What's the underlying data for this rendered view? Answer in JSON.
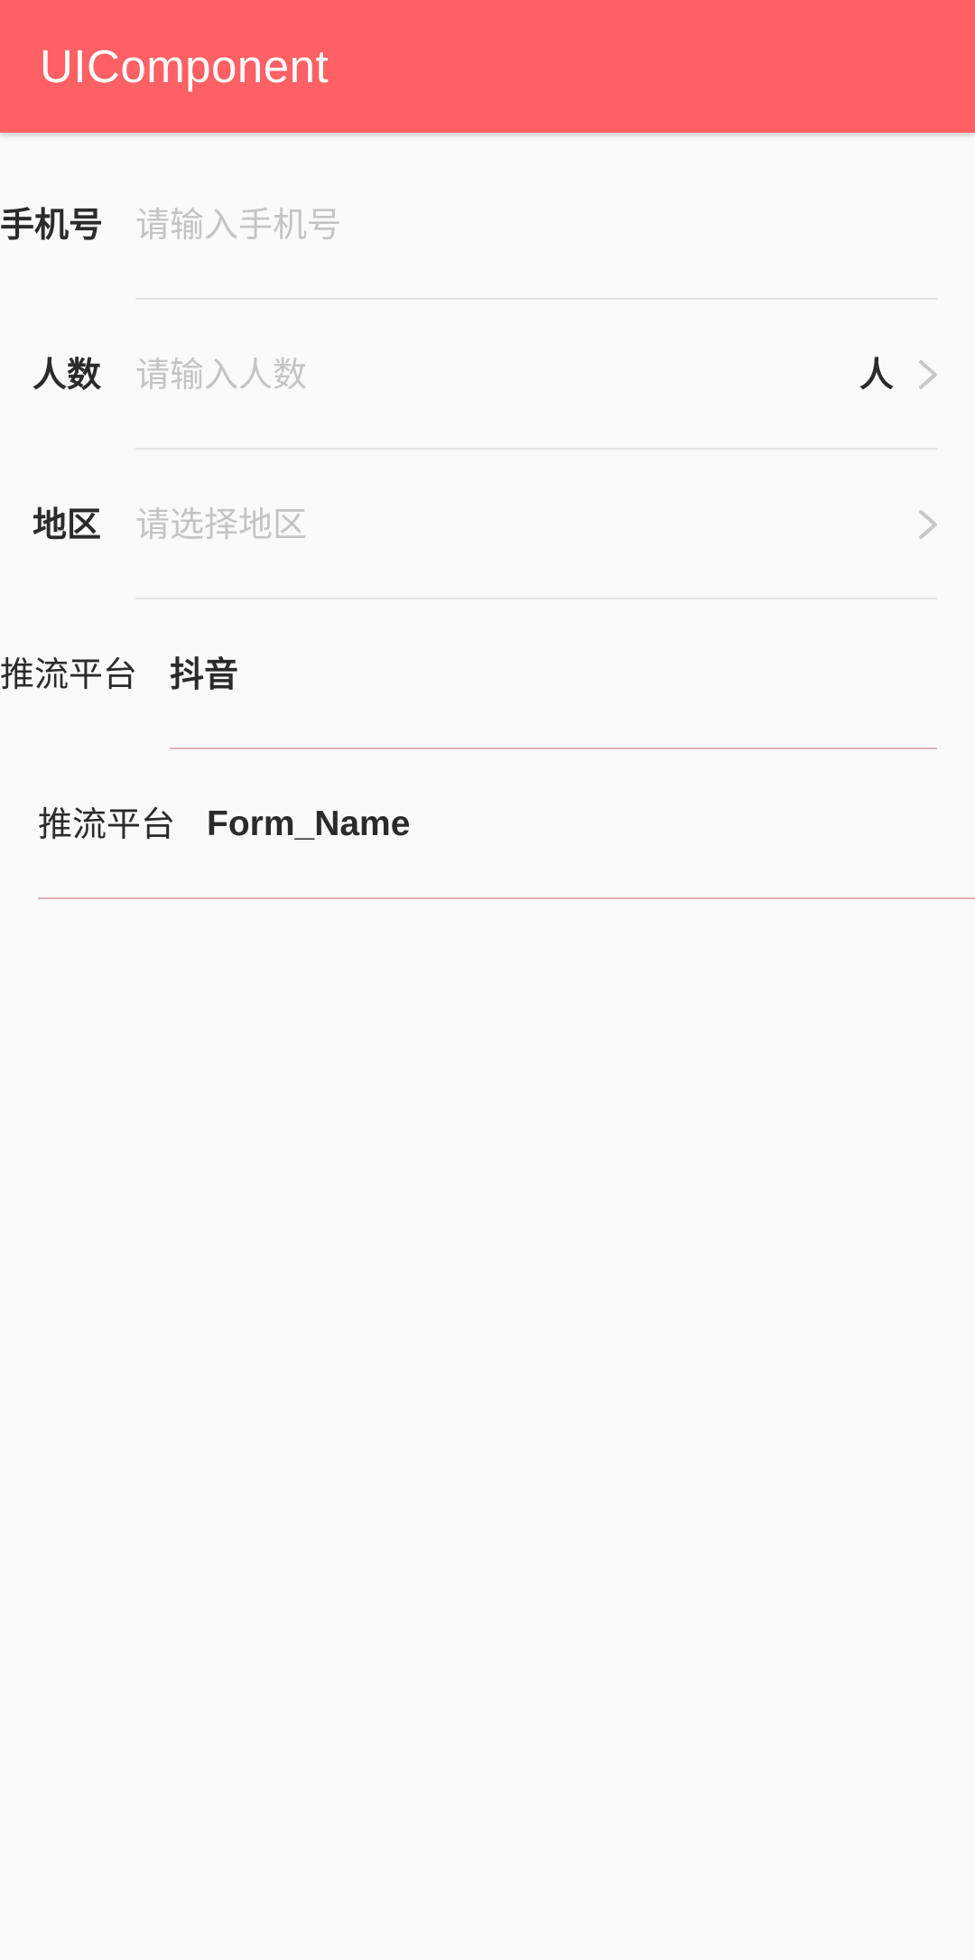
{
  "app_bar": {
    "title": "UIComponent",
    "color": "#ff6064"
  },
  "form": {
    "phone": {
      "label": "手机号",
      "placeholder": "请输入手机号",
      "value": ""
    },
    "people": {
      "label": "人数",
      "placeholder": "请输入人数",
      "value": "",
      "unit": "人",
      "icon": "chevron-right-icon"
    },
    "region": {
      "label": "地区",
      "placeholder": "请选择地区",
      "value": "",
      "icon": "chevron-right-icon"
    },
    "platform_1": {
      "label": "推流平台",
      "value": "抖音"
    },
    "platform_2": {
      "label": "推流平台",
      "value": "Form_Name"
    }
  },
  "colors": {
    "placeholder": "#c4c4c4",
    "text": "#2b2b2b",
    "divider": "#e4e4e4",
    "accent_divider": "#e0b4b8"
  }
}
